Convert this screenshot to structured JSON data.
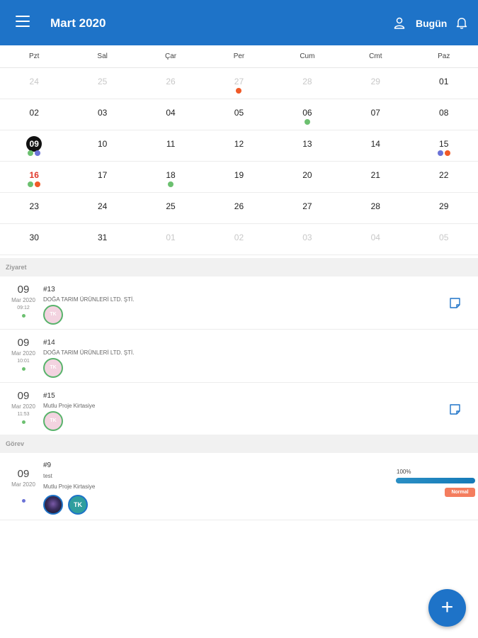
{
  "header": {
    "title": "Mart 2020",
    "today_label": "Bugün"
  },
  "calendar": {
    "weekdays": [
      "Pzt",
      "Sal",
      "Çar",
      "Per",
      "Cum",
      "Cmt",
      "Paz"
    ],
    "weeks": [
      [
        {
          "d": "24",
          "muted": true
        },
        {
          "d": "25",
          "muted": true
        },
        {
          "d": "26",
          "muted": true
        },
        {
          "d": "27",
          "muted": true,
          "dots": [
            "#f05a28"
          ]
        },
        {
          "d": "28",
          "muted": true
        },
        {
          "d": "29",
          "muted": true
        },
        {
          "d": "01"
        }
      ],
      [
        {
          "d": "02"
        },
        {
          "d": "03"
        },
        {
          "d": "04"
        },
        {
          "d": "05"
        },
        {
          "d": "06",
          "dots": [
            "#6cc070"
          ]
        },
        {
          "d": "07"
        },
        {
          "d": "08"
        }
      ],
      [
        {
          "d": "09",
          "today": true,
          "dots": [
            "#6cc070",
            "#6b72d6"
          ]
        },
        {
          "d": "10"
        },
        {
          "d": "11"
        },
        {
          "d": "12"
        },
        {
          "d": "13"
        },
        {
          "d": "14"
        },
        {
          "d": "15",
          "dots": [
            "#6b72d6",
            "#f05a28"
          ]
        }
      ],
      [
        {
          "d": "16",
          "holiday": true,
          "dots": [
            "#6cc070",
            "#f05a28"
          ]
        },
        {
          "d": "17"
        },
        {
          "d": "18",
          "dots": [
            "#6cc070"
          ]
        },
        {
          "d": "19"
        },
        {
          "d": "20"
        },
        {
          "d": "21"
        },
        {
          "d": "22"
        }
      ],
      [
        {
          "d": "23"
        },
        {
          "d": "24"
        },
        {
          "d": "25"
        },
        {
          "d": "26"
        },
        {
          "d": "27"
        },
        {
          "d": "28"
        },
        {
          "d": "29"
        }
      ],
      [
        {
          "d": "30"
        },
        {
          "d": "31"
        },
        {
          "d": "01",
          "muted": true
        },
        {
          "d": "02",
          "muted": true
        },
        {
          "d": "03",
          "muted": true
        },
        {
          "d": "04",
          "muted": true
        },
        {
          "d": "05",
          "muted": true
        }
      ]
    ]
  },
  "visits": {
    "section_label": "Ziyaret",
    "items": [
      {
        "day": "09",
        "month": "Mar 2020",
        "time": "09:12",
        "number": "#13",
        "company": "DOĞA TARIM ÜRÜNLERİ LTD. ŞTİ.",
        "avatar": "TK",
        "dot_color": "#6cc070",
        "has_note": true
      },
      {
        "day": "09",
        "month": "Mar 2020",
        "time": "10:01",
        "number": "#14",
        "company": "DOĞA TARIM ÜRÜNLERİ LTD. ŞTİ.",
        "avatar": "TK",
        "dot_color": "#6cc070",
        "has_note": false
      },
      {
        "day": "09",
        "month": "Mar 2020",
        "time": "11:53",
        "number": "#15",
        "company": "Mutlu Proje Kirtasiye",
        "avatar": "TK",
        "dot_color": "#6cc070",
        "has_note": true
      }
    ]
  },
  "tasks": {
    "section_label": "Görev",
    "items": [
      {
        "day": "09",
        "month": "Mar 2020",
        "number": "#9",
        "subject": "test",
        "company": "Mutlu Proje Kirtasiye",
        "avatar": "TK",
        "dot_color": "#6b72d6",
        "progress_label": "100%",
        "progress": 1.0,
        "priority": "Normal"
      }
    ]
  },
  "colors": {
    "primary": "#1e73c8",
    "green": "#6cc070",
    "purple": "#6b72d6",
    "orange": "#f05a28",
    "badge": "#f47d5e"
  },
  "icons": {
    "menu": "menu-icon",
    "user": "user-icon",
    "bell": "bell-icon",
    "note": "note-icon",
    "add": "plus-icon"
  },
  "fab_label": "+"
}
